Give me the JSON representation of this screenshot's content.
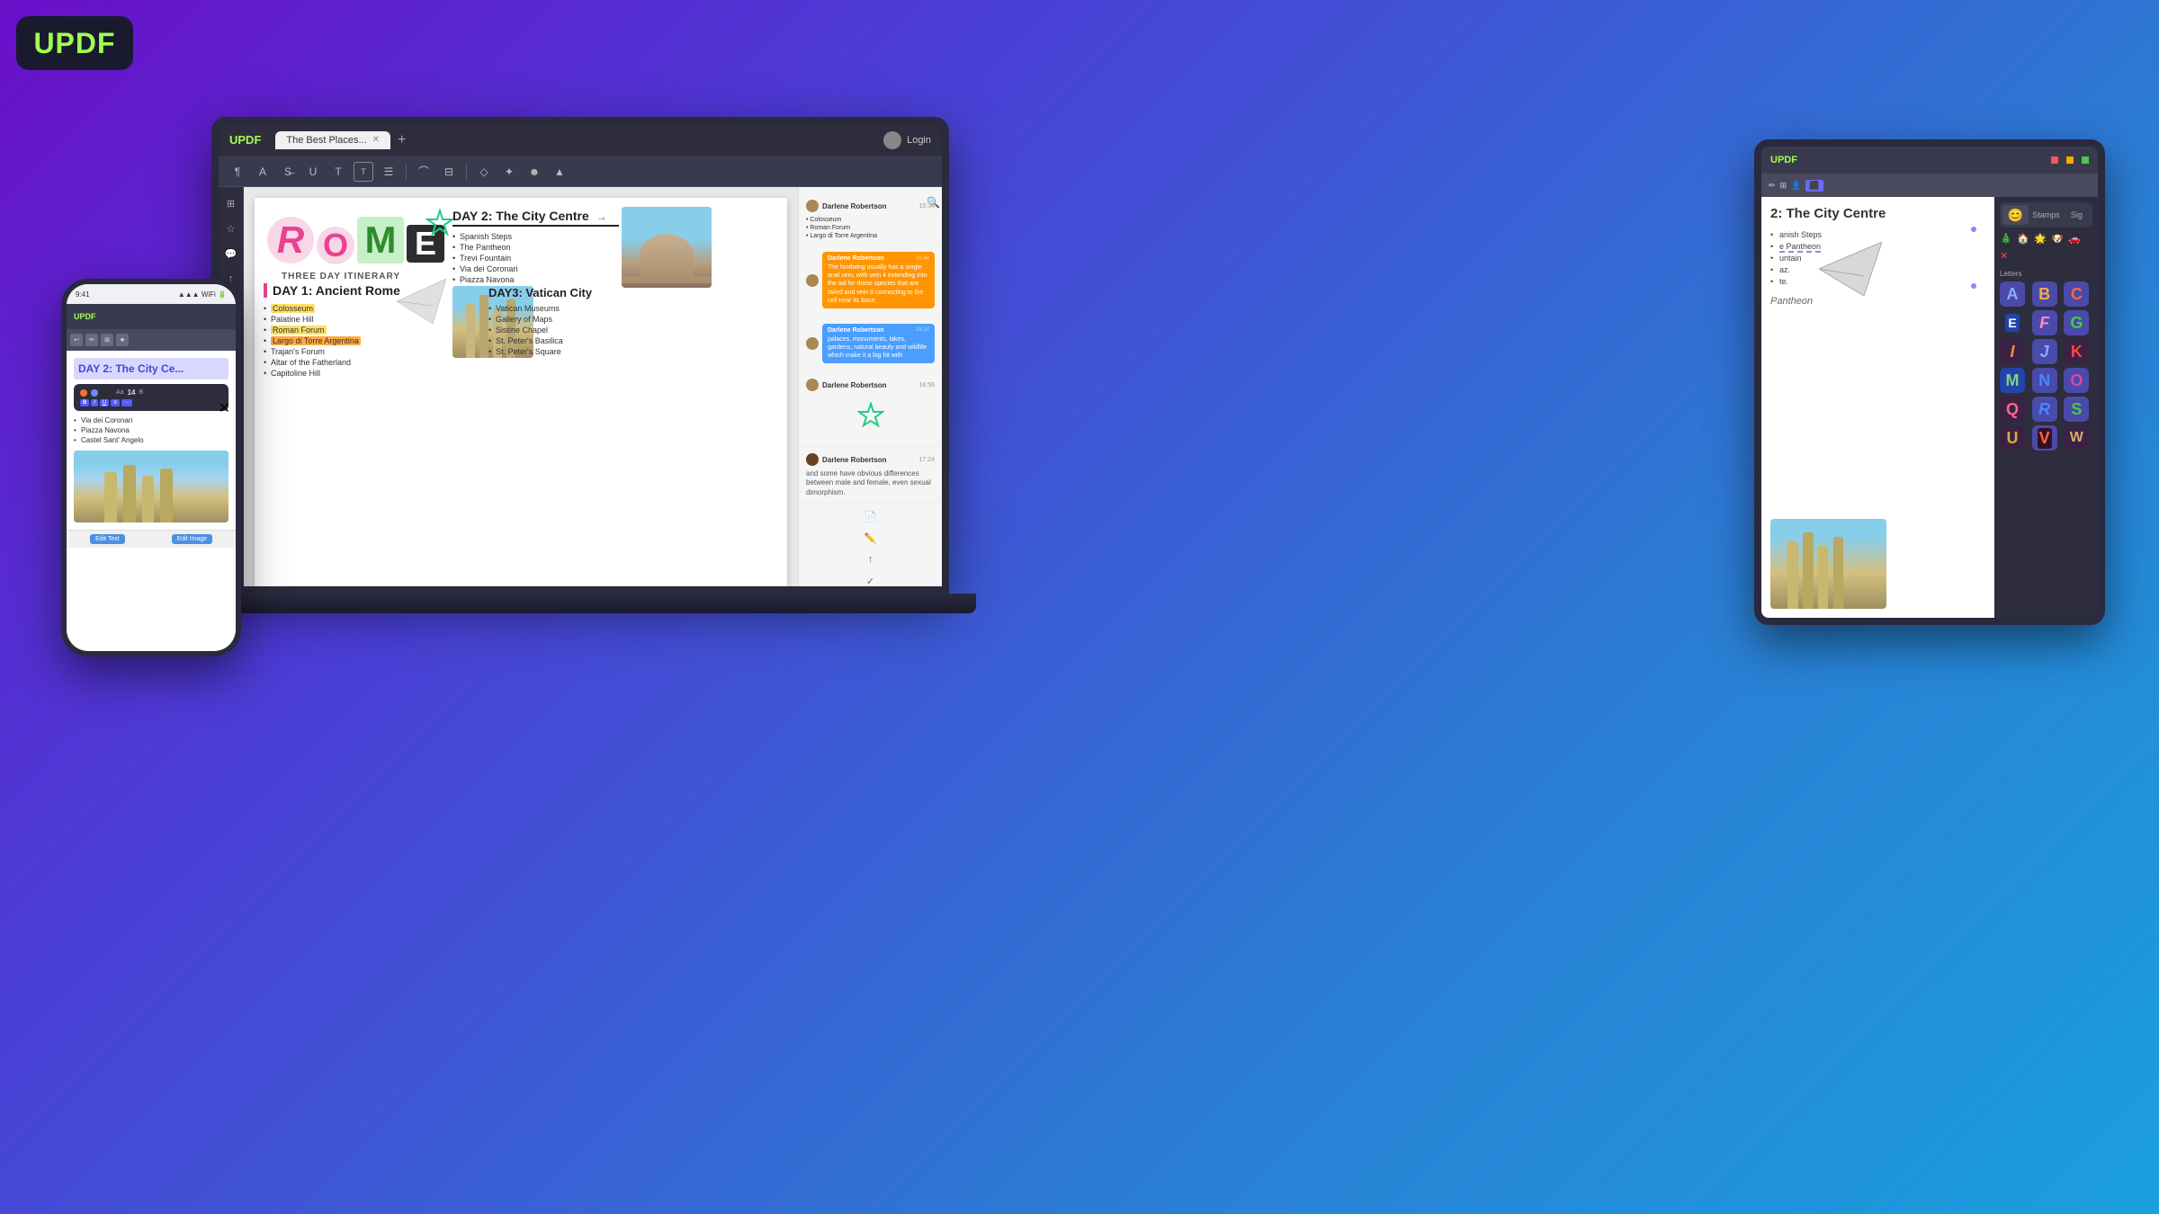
{
  "app": {
    "name": "UPDF",
    "logo_color": "#a0ff50"
  },
  "laptop": {
    "tab_name": "The Best Places...",
    "login_label": "Login",
    "toolbar_icons": [
      "☰",
      "A",
      "S",
      "T",
      "T",
      "T",
      "☰",
      "Ꭿ",
      "⊟",
      "✦",
      "⊕",
      "☻",
      "▲"
    ],
    "pdf": {
      "title": "ROME",
      "subtitle": "THREE DAY ITINERARY",
      "star_decoration": "✦",
      "day1": {
        "heading": "DAY 1: Ancient Rome",
        "items": [
          {
            "text": "Colosseum",
            "highlight": "yellow"
          },
          {
            "text": "Palatine Hill",
            "highlight": "none"
          },
          {
            "text": "Roman Forum",
            "highlight": "yellow"
          },
          {
            "text": "Largo di Torre Argentina",
            "highlight": "orange"
          },
          {
            "text": "Trajan's Forum",
            "highlight": "none"
          },
          {
            "text": "Altar of the Fatherland",
            "highlight": "none"
          },
          {
            "text": "Capitoline Hill",
            "highlight": "none"
          }
        ]
      },
      "day2": {
        "heading": "DAY 2: The City Centre",
        "items": [
          "Spanish Steps",
          "The Pantheon",
          "Trevi Fountain",
          "Via dei Coronari",
          "Piazza Navona",
          "Castel Sant' Angelo"
        ]
      },
      "day3": {
        "heading": "DAY3: Vatican City",
        "items": [
          "Vatican Museums",
          "Gallery of Maps",
          "Sistine Chapel",
          "St. Peter's Basilica",
          "St. Peter's Square"
        ]
      }
    },
    "comments": [
      {
        "user": "Darlene Robertson",
        "time": "15:34",
        "items": [
          "Colosseum",
          "Roman Forum",
          "Largo di Torre Argentina"
        ],
        "type": "list"
      },
      {
        "user": "Darlene Robertson",
        "time": "15:44",
        "text": "The hindwing usually has a single anal vein, with vein 4 extending into the tail for those species that are tailed and vein 8 connecting to the cell near its base.",
        "type": "orange_bubble"
      },
      {
        "user": "Darlene Robertson",
        "time": "16:14",
        "text": "palaces, monuments, lakes, gardens, natural beauty and wildlife which make it a big hit with",
        "type": "blue_bubble"
      },
      {
        "user": "Darlene Robertson",
        "time": "16:56",
        "type": "star"
      },
      {
        "user": "Darlene Robertson",
        "time": "17:24",
        "text": "and some have obvious differences between male and female, even sexual dimorphism.",
        "type": "plain"
      }
    ]
  },
  "phone": {
    "status": "9:41",
    "day2_heading": "DAY 2: The City Ce...",
    "list_items": [
      "Via dei Coronari",
      "Piazza Navona",
      "Castel Sant' Angelo"
    ],
    "popup": {
      "color1": "#ff6b35",
      "color2": "#6b8eff",
      "color3": "#2d2d2d",
      "size_label": "Aa",
      "size_value": "14",
      "style_bold": "B",
      "style_italic": "I",
      "style_underline": "U"
    },
    "bottom_buttons": [
      "Edit Text",
      "Edit Image"
    ]
  },
  "tablet": {
    "day2_heading": "2: The City Centre",
    "list_items": [
      "anish Steps",
      "e Pantheon",
      "untain",
      "az.",
      "te."
    ],
    "pantheon_label": "Pantheon",
    "sticker_panel": {
      "tabs": [
        "Stickers",
        "Stamps",
        "Signature"
      ],
      "section_title": "Letters",
      "letters": [
        "A",
        "B",
        "C",
        "E",
        "F",
        "G",
        "I",
        "J",
        "K",
        "M",
        "N",
        "O",
        "Q",
        "R",
        "S",
        "U",
        "V",
        "W"
      ]
    }
  },
  "colors": {
    "background_start": "#6a0fc9",
    "background_end": "#1a9fe0",
    "accent_green": "#a0ff50",
    "rome_pink": "#e84393",
    "rome_green": "#2d8c2d",
    "day_heading_border": "#e84393",
    "star_color": "#22cc88",
    "highlight_yellow": "#ffe066",
    "highlight_orange": "#ffaa44"
  }
}
